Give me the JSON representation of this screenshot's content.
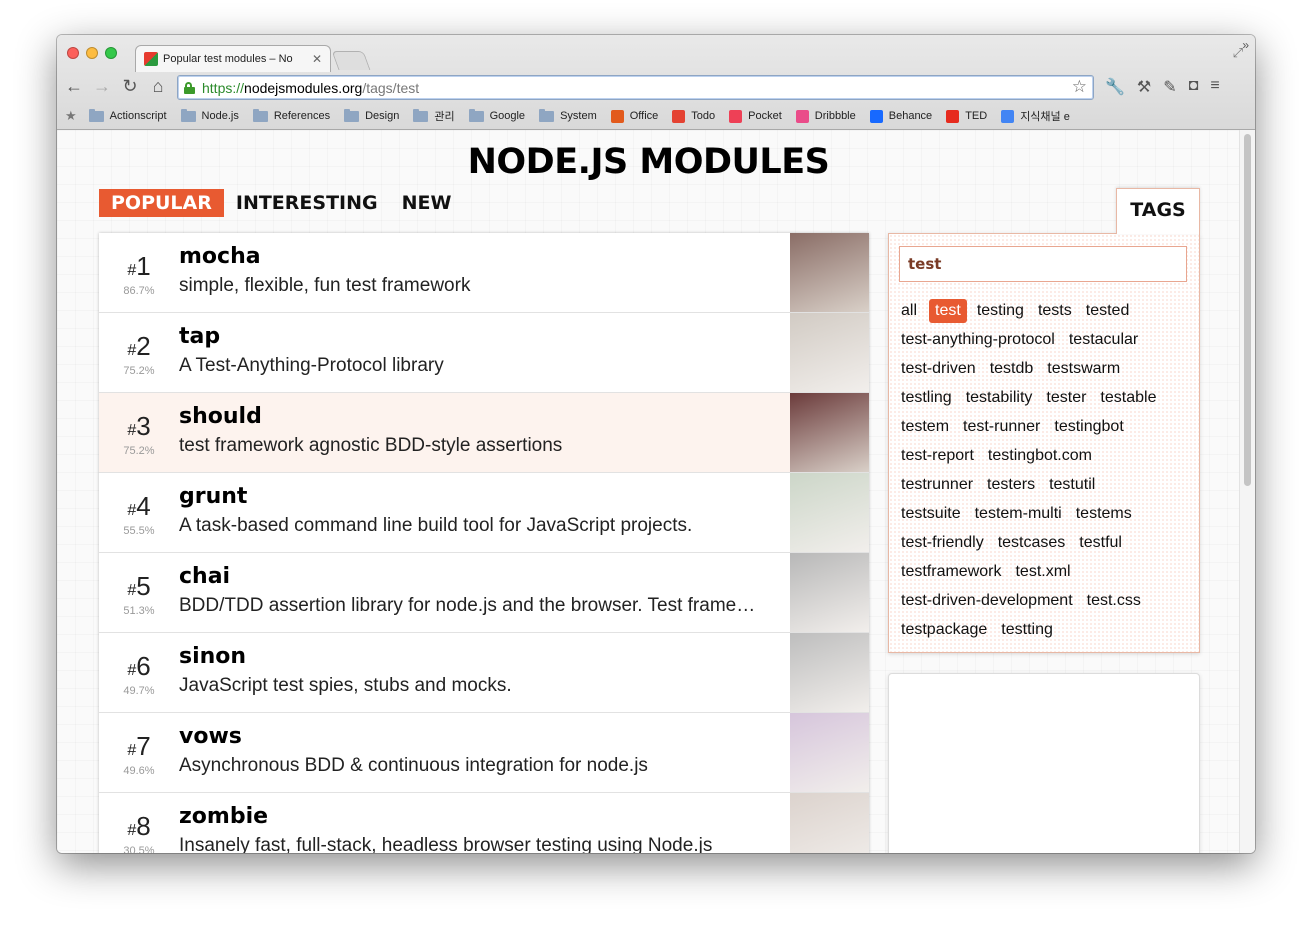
{
  "browser": {
    "tab_title": "Popular test modules – No",
    "tab_close": "✕",
    "url_scheme": "https://",
    "url_host": "nodejsmodules.org",
    "url_path": "/tags/test",
    "bookmarks": [
      {
        "label": "Actionscript",
        "icon": "folder-icon"
      },
      {
        "label": "Node.js",
        "icon": "folder-icon"
      },
      {
        "label": "References",
        "icon": "folder-icon"
      },
      {
        "label": "Design",
        "icon": "folder-icon"
      },
      {
        "label": "관리",
        "icon": "folder-icon"
      },
      {
        "label": "Google",
        "icon": "folder-icon"
      },
      {
        "label": "System",
        "icon": "folder-icon"
      },
      {
        "label": "Office",
        "icon": "office-icon",
        "color": "#e25a1c"
      },
      {
        "label": "Todo",
        "icon": "todo-icon",
        "color": "#e44232"
      },
      {
        "label": "Pocket",
        "icon": "pocket-icon",
        "color": "#ee4056"
      },
      {
        "label": "Dribbble",
        "icon": "dribbble-icon",
        "color": "#ea4c89"
      },
      {
        "label": "Behance",
        "icon": "behance-icon",
        "color": "#1769ff"
      },
      {
        "label": "TED",
        "icon": "ted-icon",
        "color": "#e62b1e"
      },
      {
        "label": "지식채널 e",
        "icon": "google-docs-icon",
        "color": "#4285f4"
      }
    ],
    "bookmarks_more": "»"
  },
  "site": {
    "title": "NODE.JS MODULES",
    "nav": [
      "POPULAR",
      "INTERESTING",
      "NEW"
    ],
    "active_nav": "POPULAR",
    "accent_color": "#e85a31"
  },
  "modules": [
    {
      "rank": "1",
      "pct": "86.7%",
      "name": "mocha",
      "desc": "simple, flexible, fun test framework",
      "avatar_color": "#8a6d66"
    },
    {
      "rank": "2",
      "pct": "75.2%",
      "name": "tap",
      "desc": "A Test-Anything-Protocol library",
      "avatar_color": "#7d6a55"
    },
    {
      "rank": "3",
      "pct": "75.2%",
      "name": "should",
      "desc": "test framework agnostic BDD-style assertions",
      "avatar_color": "#6b3b3b"
    },
    {
      "rank": "4",
      "pct": "55.5%",
      "name": "grunt",
      "desc": "A task-based command line build tool for JavaScript projects.",
      "avatar_color": "#6d8a62"
    },
    {
      "rank": "5",
      "pct": "51.3%",
      "name": "chai",
      "desc": "BDD/TDD assertion library for node.js and the browser. Test framework agnostic.",
      "avatar_color": "#333333"
    },
    {
      "rank": "6",
      "pct": "49.7%",
      "name": "sinon",
      "desc": "JavaScript test spies, stubs and mocks.",
      "avatar_color": "#444444"
    },
    {
      "rank": "7",
      "pct": "49.6%",
      "name": "vows",
      "desc": "Asynchronous BDD & continuous integration for node.js",
      "avatar_color": "#8a5a9a"
    },
    {
      "rank": "8",
      "pct": "30.5%",
      "name": "zombie",
      "desc": "Insanely fast, full-stack, headless browser testing using Node.js",
      "avatar_color": "#9a8070"
    }
  ],
  "tags": {
    "tab_label": "TAGS",
    "search_value": "test",
    "active": "test",
    "lines": [
      [
        "all",
        "test",
        "testing",
        "tests",
        "tested"
      ],
      [
        "test-anything-protocol",
        "testacular"
      ],
      [
        "test-driven",
        "testdb",
        "testswarm"
      ],
      [
        "testling",
        "testability",
        "tester",
        "testable"
      ],
      [
        "testem",
        "test-runner",
        "testingbot"
      ],
      [
        "test-report",
        "testingbot.com"
      ],
      [
        "testrunner",
        "testers",
        "testutil"
      ],
      [
        "testsuite",
        "testem-multi",
        "testems"
      ],
      [
        "test-friendly",
        "testcases",
        "testful"
      ],
      [
        "testframework",
        "test.xml"
      ],
      [
        "test-driven-development",
        "test.css"
      ],
      [
        "testpackage",
        "testting"
      ]
    ]
  }
}
